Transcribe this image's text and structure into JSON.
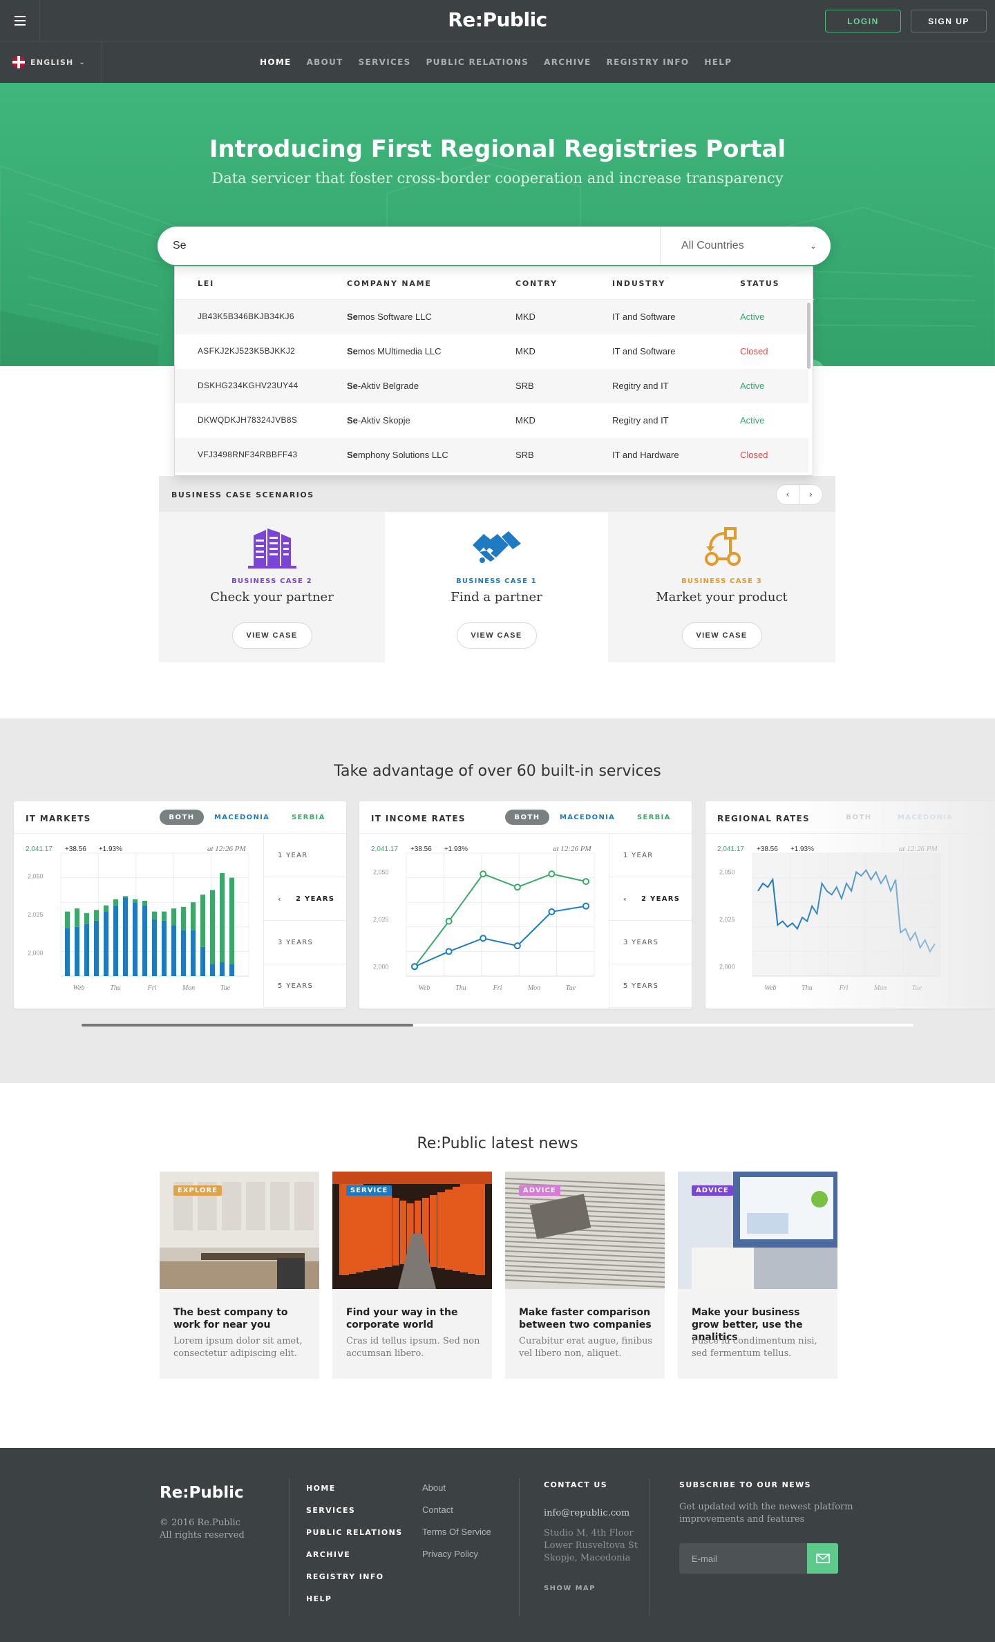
{
  "header": {
    "logo": "Re:Public",
    "login": "LOGIN",
    "signup": "SIGN UP",
    "language": "ENGLISH",
    "nav": [
      "HOME",
      "ABOUT",
      "SERVICES",
      "PUBLIC RELATIONS",
      "ARCHIVE",
      "REGISTRY INFO",
      "HELP"
    ],
    "active_nav": "HOME"
  },
  "hero": {
    "title": "Introducing First Regional Registries Portal",
    "subtitle": "Data servicer that foster cross-border cooperation and increase transparency",
    "search_value": "Se",
    "country_select": "All Countries"
  },
  "results": {
    "columns": [
      "LEI",
      "COMPANY NAME",
      "CONTRY",
      "INDUSTRY",
      "STATUS"
    ],
    "rows": [
      {
        "lei": "JB43K5B346BKJB34KJ6",
        "match": "Se",
        "rest": "mos Software LLC",
        "country": "MKD",
        "industry": "IT and Software",
        "status": "Active"
      },
      {
        "lei": "ASFKJ2KJ523K5BJKKJ2",
        "match": "Se",
        "rest": "mos MUltimedia LLC",
        "country": "MKD",
        "industry": "IT and Software",
        "status": "Closed"
      },
      {
        "lei": "DSKHG234KGHV23UY44",
        "match": "Se",
        "rest": "-Aktiv Belgrade",
        "country": "SRB",
        "industry": "Regitry and IT",
        "status": "Active"
      },
      {
        "lei": "DKWQDKJH78324JVB8S",
        "match": "Se",
        "rest": "-Aktiv Skopje",
        "country": "MKD",
        "industry": "Regitry and IT",
        "status": "Active"
      },
      {
        "lei": "VFJ3498RNF34RBBFF43",
        "match": "Se",
        "rest": "mphony Solutions LLC",
        "country": "SRB",
        "industry": "IT and Hardware",
        "status": "Closed"
      }
    ]
  },
  "business_cases": {
    "heading": "BUSINESS CASE SCENARIOS",
    "cards": [
      {
        "tag": "BUSINESS CASE 2",
        "title": "Check your partner",
        "button": "VIEW CASE",
        "color": "#7a45d6"
      },
      {
        "tag": "BUSINESS CASE 1",
        "title": "Find a partner",
        "button": "VIEW CASE",
        "color": "#1f7bc1"
      },
      {
        "tag": "BUSINESS CASE 3",
        "title": "Market your product",
        "button": "VIEW CASE",
        "color": "#e29a2b"
      }
    ]
  },
  "services": {
    "heading": "Take advantage of over 60 built-in services",
    "filters": [
      "BOTH",
      "MACEDONIA",
      "SERBIA"
    ],
    "periods": [
      "1 YEAR",
      "2 YEARS",
      "3 YEARS",
      "5 YEARS"
    ],
    "active_period": "2 YEARS",
    "stats": {
      "value": "2,041.17",
      "change": "+38.56",
      "pct": "+1.93%",
      "time": "at 12:26 PM"
    },
    "widgets": [
      "IT MARKETS",
      "IT INCOME RATES",
      "REGIONAL RATES"
    ],
    "scroll_position": 0.4
  },
  "chart_data": [
    {
      "type": "bar",
      "title": "IT MARKETS",
      "x_ticks": [
        "Web",
        "Thu",
        "Fri",
        "Mon",
        "Tue"
      ],
      "y_ticks": [
        "2,000",
        "2,025",
        "2,050"
      ],
      "ylim": [
        1985,
        2065
      ],
      "series": [
        {
          "name": "MACEDONIA",
          "values": [
            2016,
            2017,
            2019,
            2021,
            2027,
            2031,
            2036,
            2033,
            2031,
            2022,
            2021,
            2018,
            2015,
            2015,
            2004,
            1993,
            1994,
            1993
          ]
        },
        {
          "name": "SERBIA",
          "values": [
            2027,
            2029,
            2026,
            2028,
            2031,
            2035,
            2037,
            2035,
            2034,
            2027,
            2027,
            2029,
            2030,
            2033,
            2038,
            2041,
            2052,
            2049
          ]
        }
      ]
    },
    {
      "type": "line",
      "title": "IT INCOME RATES",
      "x": [
        "Web",
        "Thu",
        "Fri",
        "Mon",
        "Tue",
        "Tue"
      ],
      "y_ticks": [
        "2,000",
        "2,025",
        "2,050"
      ],
      "ylim": [
        1995,
        2060
      ],
      "series": [
        {
          "name": "SERBIA",
          "values": [
            2000,
            2024,
            2049,
            2042,
            2049,
            2045
          ]
        },
        {
          "name": "MACEDONIA",
          "values": [
            2000,
            2008,
            2015,
            2011,
            2029,
            2032
          ]
        }
      ]
    },
    {
      "type": "area",
      "title": "REGIONAL RATES",
      "x_ticks": [
        "Web",
        "Thu",
        "Fri",
        "Mon",
        "Tue"
      ],
      "y_ticks": [
        "2,000",
        "2,025",
        "2,050"
      ],
      "ylim": [
        1995,
        2060
      ],
      "series": [
        {
          "name": "REGIONAL",
          "values": [
            2040,
            2044,
            2042,
            2046,
            2022,
            2024,
            2021,
            2023,
            2020,
            2026,
            2024,
            2032,
            2028,
            2044,
            2040,
            2038,
            2042,
            2036,
            2044,
            2040,
            2050,
            2048,
            2051,
            2046,
            2050,
            2044,
            2048,
            2040,
            2046,
            2018,
            2020,
            2014,
            2018,
            2010,
            2014,
            2008,
            2012
          ]
        }
      ]
    }
  ],
  "news": {
    "heading": "Re:Public latest news",
    "items": [
      {
        "badge": "EXPLORE",
        "badge_color": "#e0a24a",
        "title": "The best company to work for near you",
        "desc": "Lorem ipsum dolor sit amet, consectetur adipiscing elit."
      },
      {
        "badge": "SERVICE",
        "badge_color": "#1f7bc1",
        "title": "Find your way in the corporate world",
        "desc": "Cras id tellus ipsum. Sed non accumsan libero."
      },
      {
        "badge": "ADVICE",
        "badge_color": "#d67bd6",
        "title": "Make faster comparison between two companies",
        "desc": "Curabitur erat augue, finibus vel libero non, aliquet."
      },
      {
        "badge": "ADVICE",
        "badge_color": "#7a45d6",
        "title": "Make your business grow better, use the analitics",
        "desc": "Fusce id condimentum nisi, sed fermentum tellus."
      }
    ]
  },
  "footer": {
    "logo": "Re:Public",
    "copyright": "© 2016 Re.Public",
    "rights": "All rights reserved",
    "main_links": [
      "HOME",
      "SERVICES",
      "PUBLIC RELATIONS",
      "ARCHIVE",
      "REGISTRY INFO",
      "HELP"
    ],
    "secondary_links": [
      "About",
      "Contact",
      "Terms Of Service",
      "Privacy Policy"
    ],
    "contact_heading": "CONTACT US",
    "email": "info@republic.com",
    "address": [
      "Studio M, 4th Floor",
      "Lower Rusveltova St",
      "Skopje, Macedonia"
    ],
    "show_map": "SHOW MAP",
    "subscribe_heading": "SUBSCRIBE TO OUR NEWS",
    "subscribe_text": "Get updated with the newest platform improvements and features",
    "email_placeholder": "E-mail"
  },
  "colors": {
    "brand_green": "#3fb67c",
    "blue": "#1f7bc1",
    "green": "#3aa868",
    "red": "#e54b4b",
    "dark": "#3c4143"
  }
}
